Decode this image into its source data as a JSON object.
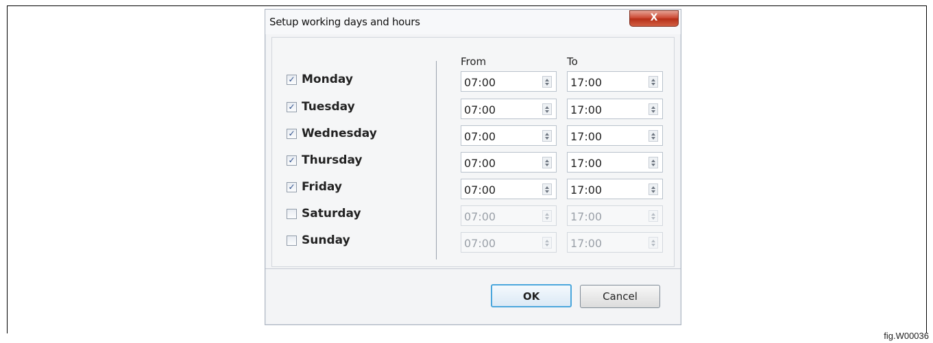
{
  "dialog": {
    "title": "Setup working days and hours",
    "close_label": "X",
    "from_header": "From",
    "to_header": "To",
    "ok_label": "OK",
    "cancel_label": "Cancel"
  },
  "days": [
    {
      "label": "Monday",
      "checked": true,
      "from": "07:00",
      "to": "17:00"
    },
    {
      "label": "Tuesday",
      "checked": true,
      "from": "07:00",
      "to": "17:00"
    },
    {
      "label": "Wednesday",
      "checked": true,
      "from": "07:00",
      "to": "17:00"
    },
    {
      "label": "Thursday",
      "checked": true,
      "from": "07:00",
      "to": "17:00"
    },
    {
      "label": "Friday",
      "checked": true,
      "from": "07:00",
      "to": "17:00"
    },
    {
      "label": "Saturday",
      "checked": false,
      "from": "07:00",
      "to": "17:00"
    },
    {
      "label": "Sunday",
      "checked": false,
      "from": "07:00",
      "to": "17:00"
    }
  ],
  "figure_label": "fig.W00036",
  "colors": {
    "accent": "#4aa6dc",
    "close": "#c9432c"
  }
}
